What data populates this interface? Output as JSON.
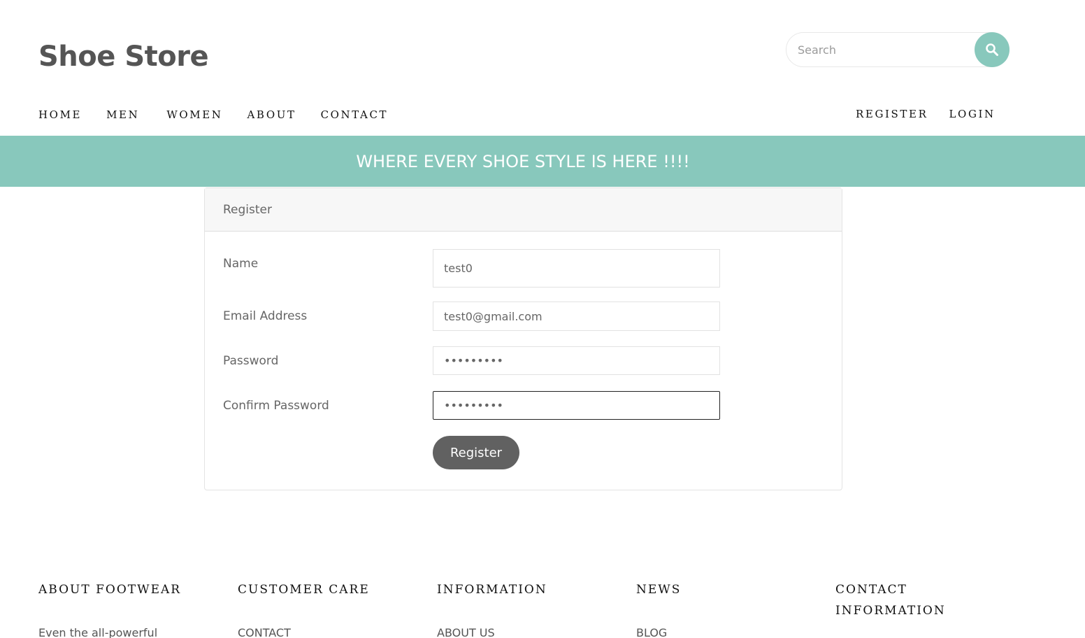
{
  "header": {
    "site_title": "Shoe Store",
    "search_placeholder": "Search"
  },
  "nav": {
    "left": [
      "HOME",
      "MEN",
      "WOMEN",
      "ABOUT",
      "CONTACT"
    ],
    "right": [
      "REGISTER",
      "LOGIN"
    ]
  },
  "banner": {
    "text": "WHERE EVERY SHOE STYLE IS HERE !!!!"
  },
  "form": {
    "title": "Register",
    "name_label": "Name",
    "name_value": "test0",
    "email_label": "Email Address",
    "email_value": "test0@gmail.com",
    "password_label": "Password",
    "password_value": "123456789",
    "confirm_label": "Confirm Password",
    "confirm_value": "123456789",
    "submit_label": "Register"
  },
  "footer": {
    "about_heading": "ABOUT FOOTWEAR",
    "about_text": "Even the all-powerful",
    "care_heading": "CUSTOMER CARE",
    "care_link": "Contact",
    "info_heading": "INFORMATION",
    "info_link": "About us",
    "news_heading": "NEWS",
    "news_link": "Blog",
    "contact_heading_line1": "CONTACT",
    "contact_heading_line2": "INFORMATION"
  },
  "colors": {
    "accent": "#88c8bc",
    "button_dark": "#616161"
  },
  "icons": {
    "search": "search-icon"
  }
}
